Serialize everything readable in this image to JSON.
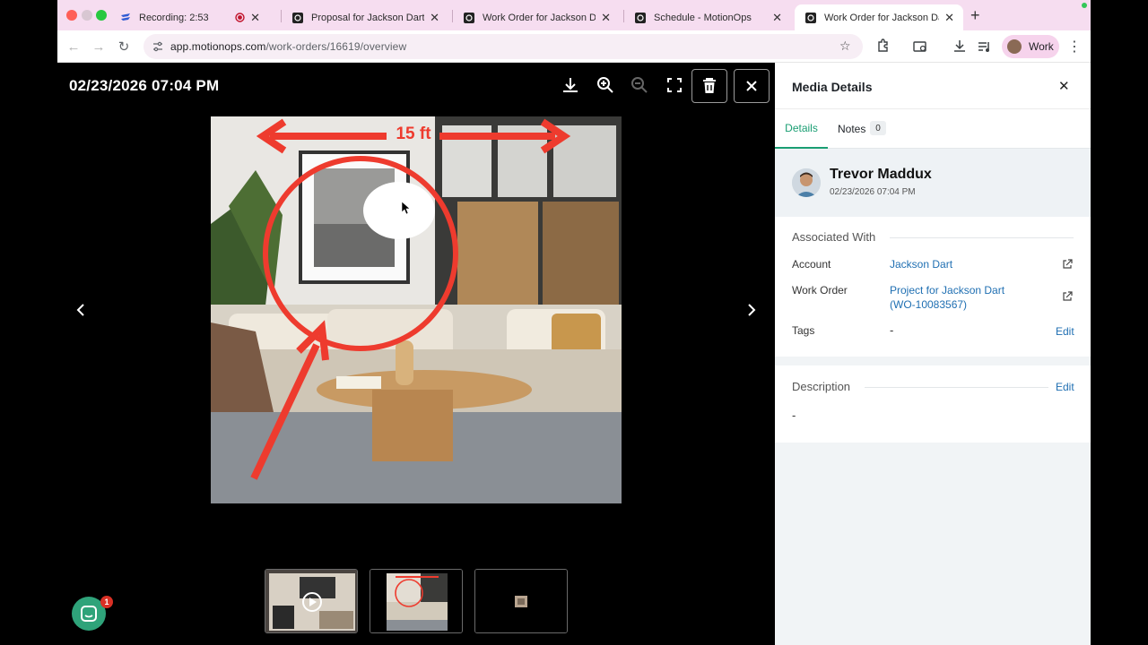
{
  "browser": {
    "tabs": [
      {
        "title": "Recording: 2:53",
        "active": false
      },
      {
        "title": "Proposal for Jackson Dart - M",
        "active": false
      },
      {
        "title": "Work Order for Jackson Dart",
        "active": false
      },
      {
        "title": "Schedule - MotionOps",
        "active": false
      },
      {
        "title": "Work Order for Jackson Dart",
        "active": true
      }
    ],
    "url_host": "app.motionops.com",
    "url_path": "/work-orders/16619/overview",
    "profile_label": "Work"
  },
  "viewer": {
    "timestamp": "02/23/2026 07:04 PM",
    "image_annotation": "15 ft",
    "thumbnails": [
      "video",
      "photo",
      "image"
    ],
    "chat_badge": "1"
  },
  "panel": {
    "title": "Media Details",
    "tabs": {
      "details": "Details",
      "notes": "Notes",
      "notes_count": "0"
    },
    "user": {
      "name": "Trevor Maddux",
      "date": "02/23/2026 07:04 PM"
    },
    "associated": {
      "title": "Associated With",
      "account_label": "Account",
      "account_value": "Jackson Dart",
      "work_order_label": "Work Order",
      "work_order_value_1": "Project for Jackson Dart",
      "work_order_value_2": "(WO-10083567)",
      "tags_label": "Tags",
      "tags_value": "-",
      "tags_edit": "Edit"
    },
    "description": {
      "title": "Description",
      "edit": "Edit",
      "value": "-"
    }
  },
  "colors": {
    "accent": "#1a9e73",
    "link": "#1f6fb2",
    "tabstrip": "#f6ddf0",
    "annotation": "#ee3b2e"
  }
}
